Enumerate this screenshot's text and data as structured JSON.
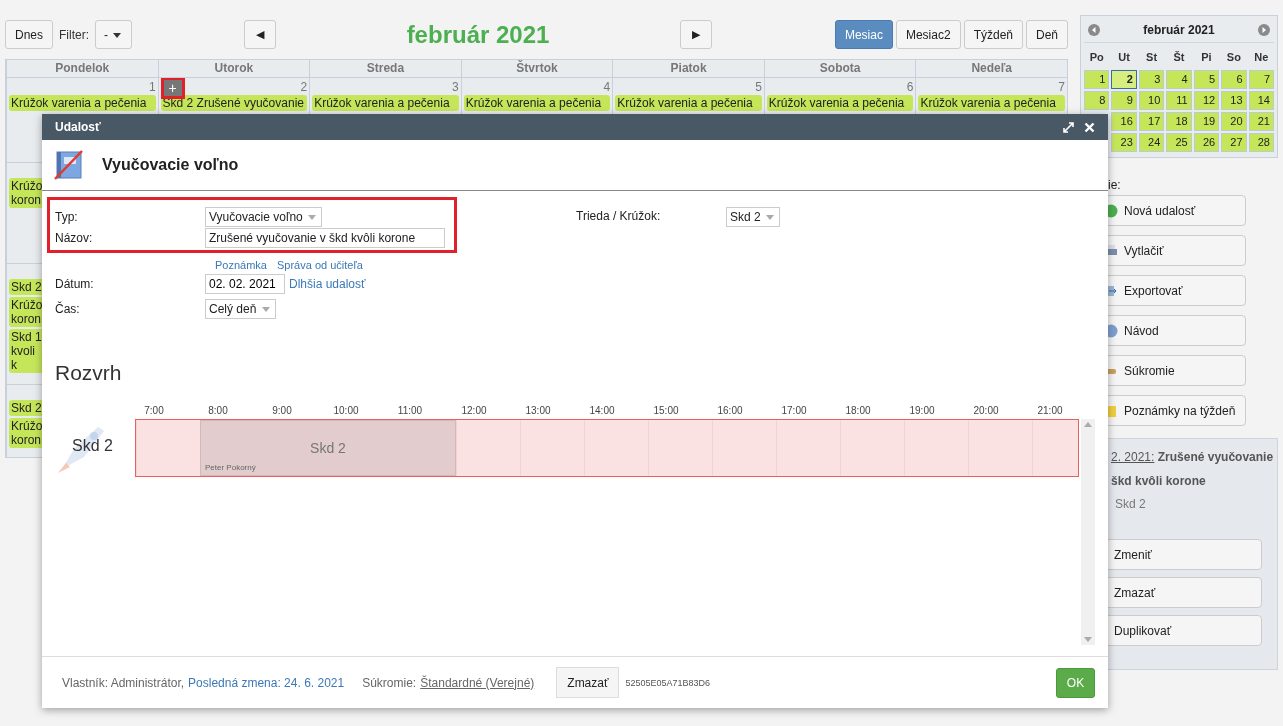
{
  "toolbar": {
    "today_button": "Dnes",
    "filter_label": "Filter:",
    "filter_value": "-",
    "prev_button": "◀",
    "next_button": "▶",
    "title": "február 2021",
    "views": [
      {
        "label": "Mesiac",
        "selected": true
      },
      {
        "label": "Mesiac2",
        "selected": false
      },
      {
        "label": "Týždeň",
        "selected": false
      },
      {
        "label": "Deň",
        "selected": false
      }
    ]
  },
  "calendar": {
    "weekdays": [
      "Pondelok",
      "Utorok",
      "Streda",
      "Štvrtok",
      "Piatok",
      "Sobota",
      "Nedeľa"
    ],
    "add_button": "+",
    "weeks": [
      {
        "days": [
          {
            "number": "1",
            "events": [
              "Krúžok varenia a pečenia"
            ]
          },
          {
            "number": "2",
            "events": [
              "Skd 2 Zrušené vyučovanie"
            ]
          },
          {
            "number": "3",
            "events": [
              "Krúžok varenia a pečenia"
            ]
          },
          {
            "number": "4",
            "events": [
              "Krúžok varenia a pečenia"
            ]
          },
          {
            "number": "5",
            "events": [
              "Krúžok varenia a pečenia"
            ]
          },
          {
            "number": "6",
            "events": [
              "Krúžok varenia a pečenia"
            ]
          },
          {
            "number": "7",
            "events": [
              "Krúžok varenia a pečenia"
            ]
          }
        ]
      },
      {
        "days": [
          {
            "events": [
              "Krúžo koron"
            ]
          }
        ]
      },
      {
        "days": [
          {
            "events": [
              "Skd 2",
              "Krúžo koron",
              "Skd 1 kvoli k"
            ]
          }
        ]
      },
      {
        "days": [
          {
            "events": [
              "Skd 2",
              "Krúžo koron"
            ]
          }
        ]
      }
    ]
  },
  "mini_calendar": {
    "title": "február 2021",
    "weekdays": [
      "Po",
      "Ut",
      "St",
      "Št",
      "Pi",
      "So",
      "Ne"
    ],
    "weeks": [
      [
        {
          "day": "1",
          "selected": false
        },
        {
          "day": "2",
          "selected": true
        },
        {
          "day": "3",
          "selected": false
        },
        {
          "day": "4",
          "selected": false
        },
        {
          "day": "5",
          "selected": false
        },
        {
          "day": "6",
          "selected": false
        },
        {
          "day": "7",
          "selected": false
        }
      ],
      [
        {
          "day": "8",
          "selected": false
        },
        {
          "day": "9",
          "selected": false
        },
        {
          "day": "10",
          "selected": false
        },
        {
          "day": "11",
          "selected": false
        },
        {
          "day": "12",
          "selected": false
        },
        {
          "day": "13",
          "selected": false
        },
        {
          "day": "14",
          "selected": false
        }
      ],
      [
        {
          "day": "16",
          "selected": false
        },
        {
          "day": "17",
          "selected": false
        },
        {
          "day": "18",
          "selected": false
        },
        {
          "day": "19",
          "selected": false
        },
        {
          "day": "20",
          "selected": false
        },
        {
          "day": "21",
          "selected": false
        }
      ],
      [
        {
          "day": "23",
          "selected": false
        },
        {
          "day": "24",
          "selected": false
        },
        {
          "day": "25",
          "selected": false
        },
        {
          "day": "26",
          "selected": false
        },
        {
          "day": "27",
          "selected": false
        },
        {
          "day": "28",
          "selected": false
        }
      ]
    ]
  },
  "actions": {
    "label": "ie:",
    "buttons": [
      {
        "label": "Nová udalosť",
        "kind": "new"
      },
      {
        "label": "Vytlačiť",
        "kind": "print"
      },
      {
        "label": "Exportovať",
        "kind": "export"
      },
      {
        "label": "Návod",
        "kind": "help"
      },
      {
        "label": "Súkromie",
        "kind": "privacy"
      },
      {
        "label": "Poznámky na týždeň",
        "kind": "notes"
      }
    ]
  },
  "event_detail": {
    "date": "2. 2021:",
    "title_line1": "Zrušené vyučovanie",
    "title_line2": "škd kvôli korone",
    "group": "Skd 2",
    "buttons": [
      "Zmeniť",
      "Zmazať",
      "Duplikovať"
    ]
  },
  "dialog": {
    "title": "Udalosť",
    "heading": "Vyučovacie voľno",
    "fields": {
      "type_label": "Typ:",
      "type_value": "Vyučovacie voľno",
      "name_label": "Názov:",
      "name_value": "Zrušené vyučovanie v škd kvôli korone",
      "links": [
        "Poznámka",
        "Správa od učiteľa"
      ],
      "date_label": "Dátum:",
      "date_value": "02. 02. 2021",
      "date_link": "Dlhšia udalosť",
      "time_label": "Čas:",
      "time_value": "Celý deň",
      "class_label": "Trieda / Krúžok:",
      "class_value": "Skd 2"
    },
    "schedule": {
      "title": "Rozvrh",
      "hours": [
        "7:00",
        "8:00",
        "9:00",
        "10:00",
        "11:00",
        "12:00",
        "13:00",
        "14:00",
        "15:00",
        "16:00",
        "17:00",
        "18:00",
        "19:00",
        "20:00",
        "21:00"
      ],
      "row_label": "Skd 2",
      "block": {
        "title": "Skd 2",
        "teacher": "Peter Pokorný"
      }
    },
    "footer": {
      "owner": "Vlastník: Administrátor,",
      "last_change": "Posledná zmena: 24. 6. 2021",
      "privacy_label": "Súkromie:",
      "privacy_value": "Štandardné (Verejné)",
      "delete_button": "Zmazať",
      "id": "52505E05A71B83D6",
      "ok_button": "OK"
    }
  }
}
